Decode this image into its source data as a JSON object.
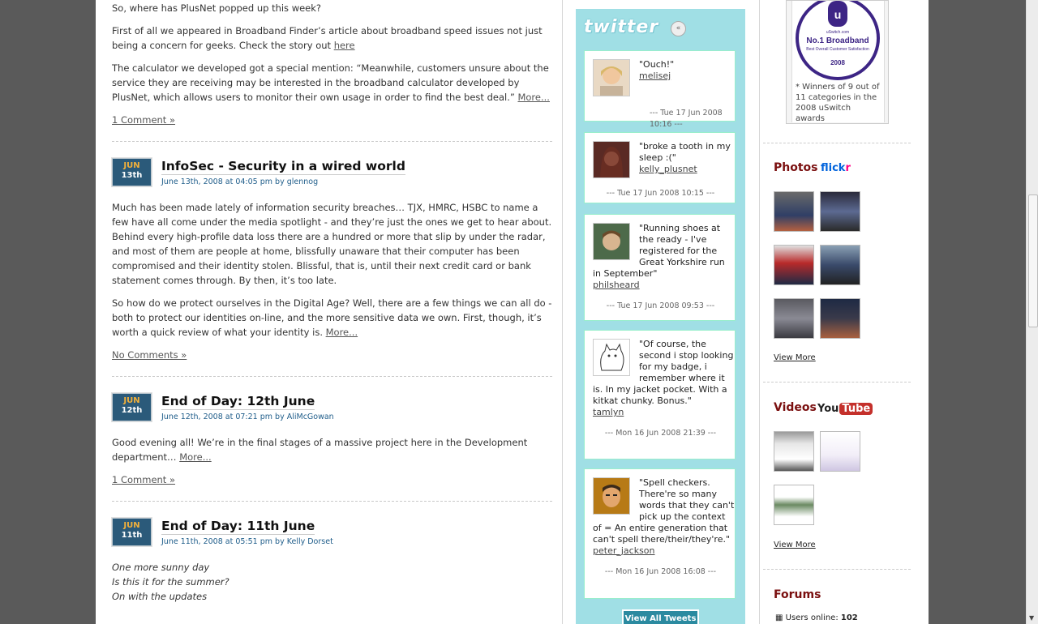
{
  "posts": {
    "intro_line": "So, where has PlusNet popped up this week?",
    "p1_text": "First of all we appeared in Broadband Finder’s article about broadband speed issues not just being a concern for geeks. Check the story out ",
    "p1_link": "here",
    "p2_text": "The calculator we developed got a special mention: “Meanwhile, customers unsure about the service they are receiving may be interested in the broadband calculator developed by PlusNet, which allows users to monitor their own usage in order to find the best deal.” ",
    "more": "More...",
    "p0_comments": "1 Comment »",
    "infosec": {
      "month": "JUN",
      "day": "13th",
      "title": "InfoSec - Security in a wired world",
      "meta": "June 13th, 2008 at 04:05 pm by glennog",
      "body1": "Much has been made lately of information security breaches… TJX, HMRC, HSBC to name a few have all come under the media spotlight - and they’re just the ones we get to hear about. Behind every high-profile data loss there are a hundred or more that slip by under the radar, and most of them are people at home, blissfully unaware that their computer has been compromised and their identity stolen. Blissful, that is, until their next credit card or bank statement comes through. By then, it’s too late.",
      "body2": "So how do we protect ourselves in the Digital Age? Well, there are a few things we can all do - both to protect our identities on-line, and the more sensitive data we own. First, though, it’s worth a quick review of what your identity is. ",
      "comments": "No Comments »"
    },
    "eod12": {
      "month": "JUN",
      "day": "12th",
      "title": "End of Day: 12th June",
      "meta": "June 12th, 2008 at 07:21 pm by AliMcGowan",
      "body": "Good evening all! We’re in the final stages of a massive project here in the Development department… ",
      "comments": "1 Comment »"
    },
    "eod11": {
      "month": "JUN",
      "day": "11th",
      "title": "End of Day: 11th June",
      "meta": "June 11th, 2008 at 05:51 pm by Kelly Dorset",
      "line1": "One more sunny day",
      "line2": "Is this it for the summer?",
      "line3": "On with the updates"
    }
  },
  "twitter": {
    "logo": "twitter",
    "collapse_icon": "«",
    "tweets": [
      {
        "text": "\"Ouch!\"",
        "user": "melisej",
        "time": "--- Tue 17 Jun 2008 10:16 ---"
      },
      {
        "text": "\"broke a tooth in my sleep :(\"",
        "user": "kelly_plusnet",
        "time": "--- Tue 17 Jun 2008 10:15 ---"
      },
      {
        "text": "\"Running shoes at the ready - I've registered for the Great Yorkshire run in September\"",
        "user": "philsheard",
        "time": "--- Tue 17 Jun 2008 09:53 ---"
      },
      {
        "text": "\"Of course, the second i stop looking for my badge, i remember where it is. In my jacket pocket. With a kitkat chunky. Bonus.\"",
        "user": "tamlyn",
        "time": "--- Mon 16 Jun 2008 21:39 ---"
      },
      {
        "text": "\"Spell checkers. There're so many words that they can't pick up the context of = An entire generation that can't spell there/their/they're.\"",
        "user": "peter_jackson",
        "time": "--- Mon 16 Jun 2008 16:08 ---"
      }
    ],
    "view_all": "View All Tweets"
  },
  "sidebar": {
    "uswitch": {
      "logo_text": "uSwitch.com",
      "badge_title": "No.1 Broadband",
      "badge_sub": "Best Overall Customer Satisfaction",
      "badge_year": "2008",
      "note": "* Winners of 9 out of 11 categories in the 2008 uSwitch awards"
    },
    "photos_title": "Photos",
    "flickr_a": "flick",
    "flickr_b": "r",
    "photos_more": "View More",
    "videos_title": "Videos",
    "yt_a": "You",
    "yt_b": "Tube",
    "videos_more": "View More",
    "forums_title": "Forums",
    "users_online_label": "Users online: ",
    "users_online_count": "102"
  }
}
